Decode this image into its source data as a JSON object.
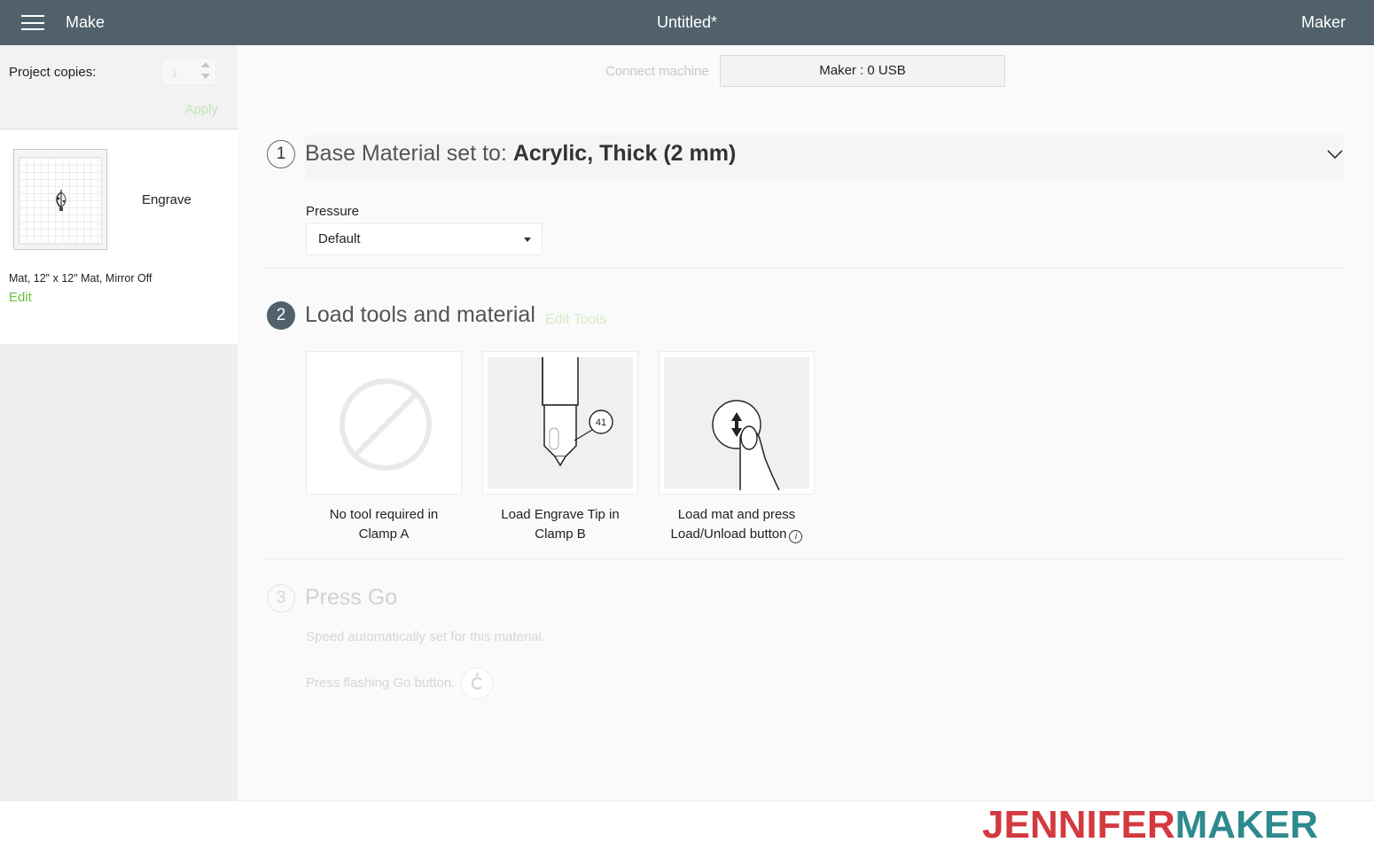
{
  "header": {
    "app_title": "Make",
    "document_title": "Untitled*",
    "machine_name": "Maker"
  },
  "left_panel": {
    "copies_label": "Project copies:",
    "copies_value": "1",
    "apply_label": "Apply",
    "mat": {
      "operation": "Engrave",
      "description": "Mat, 12\" x 12\" Mat, Mirror Off",
      "edit_label": "Edit"
    }
  },
  "connection": {
    "connect_label": "Connect machine",
    "machine_button": "Maker : 0 USB"
  },
  "step1": {
    "number": "1",
    "prefix": "Base Material set to: ",
    "material": "Acrylic, Thick (2 mm)",
    "pressure_label": "Pressure",
    "pressure_value": "Default"
  },
  "step2": {
    "number": "2",
    "title": "Load tools and material",
    "edit_tools": "Edit Tools",
    "tools": [
      {
        "line1": "No tool required in",
        "line2": "Clamp A"
      },
      {
        "line1": "Load Engrave Tip in",
        "line2": "Clamp B",
        "badge": "41"
      },
      {
        "line1": "Load mat and press",
        "line2": "Load/Unload button"
      }
    ],
    "info_glyph": "i"
  },
  "step3": {
    "number": "3",
    "title": "Press Go",
    "speed_note": "Speed automatically set for this material.",
    "go_note": "Press flashing Go button."
  },
  "brand": {
    "part1": "JENNIFER",
    "part2": "MAKER"
  },
  "colors": {
    "header_bg": "#50616b",
    "accent_green": "#6bbf3e",
    "brand_red": "#d33a3f",
    "brand_teal": "#2f8a8e"
  }
}
